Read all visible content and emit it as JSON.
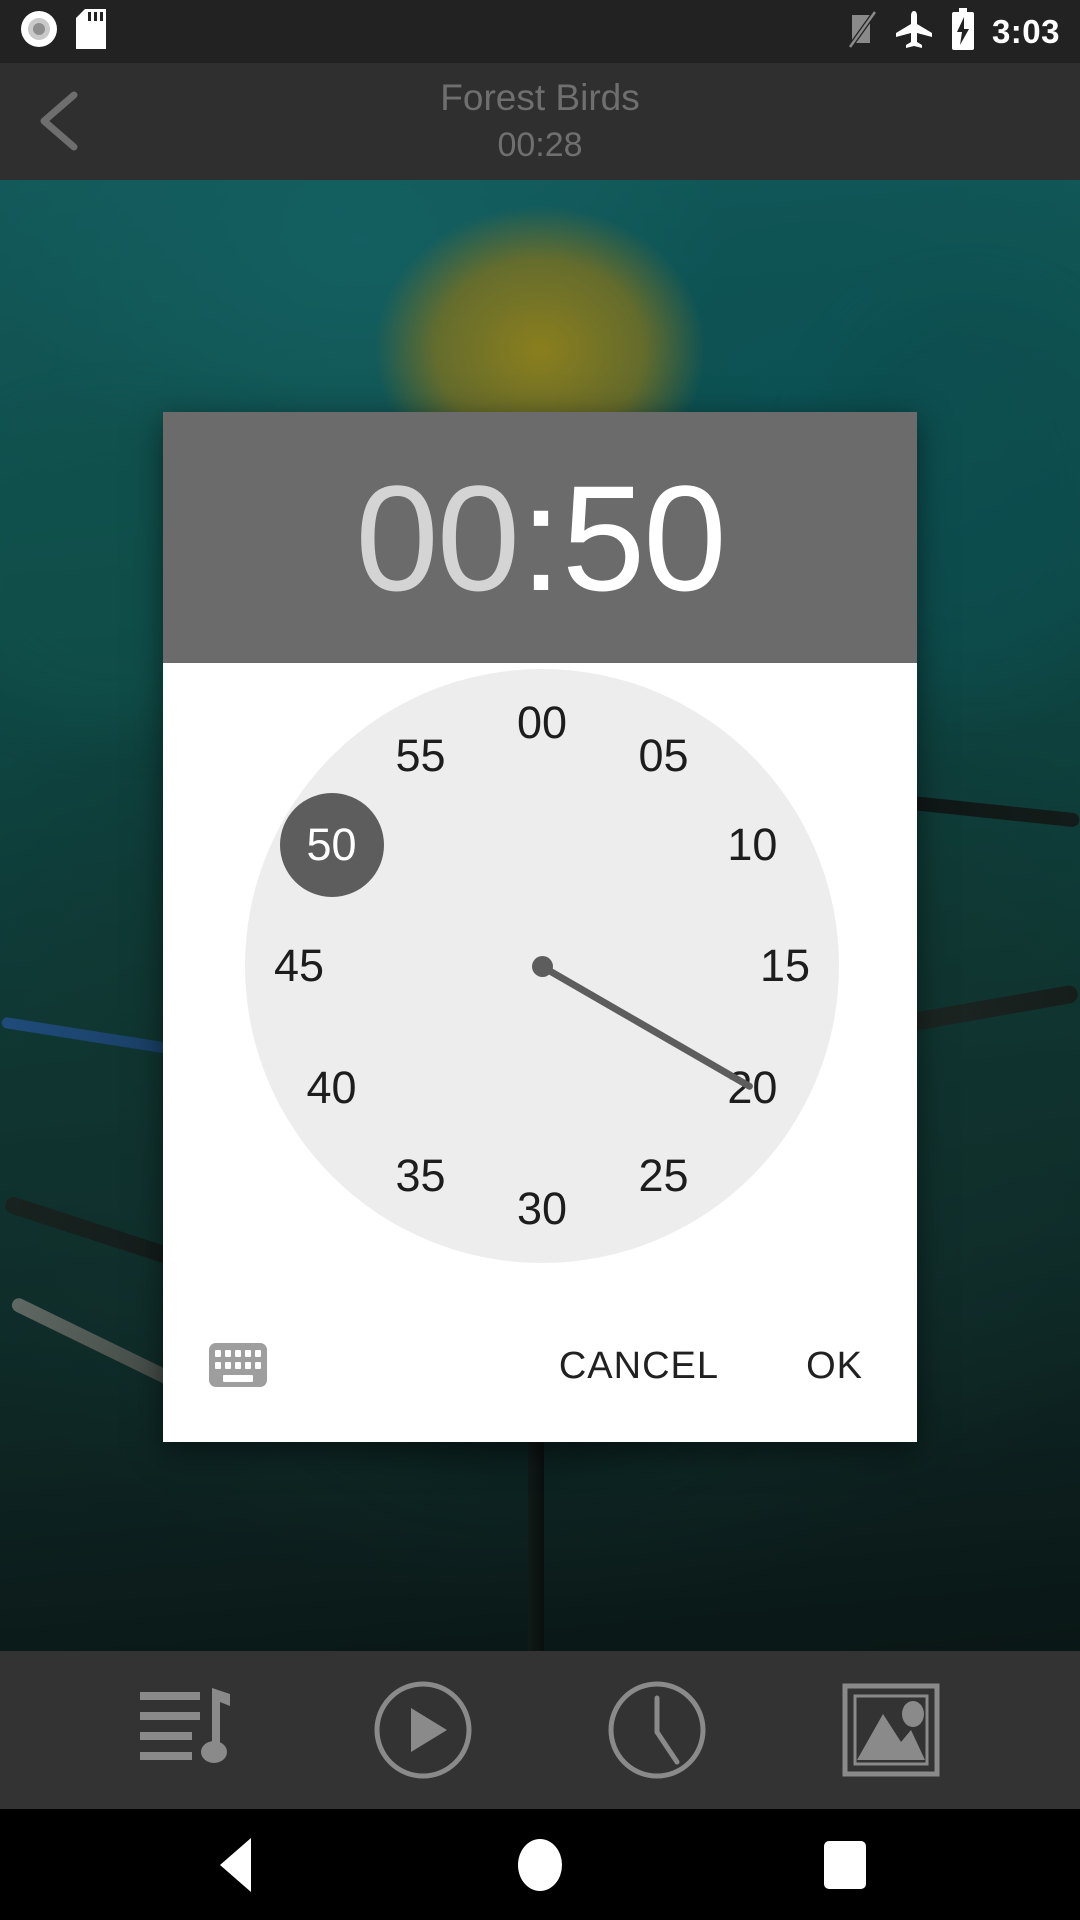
{
  "statusbar": {
    "icons_left": [
      "record-disc-icon",
      "sd-card-icon"
    ],
    "icons_right": [
      "signal-off-icon",
      "airplane-mode-icon",
      "battery-charging-icon"
    ],
    "clock": "3:03"
  },
  "appbar": {
    "back_icon": "chevron-left-icon",
    "title": "Forest Birds",
    "subtitle": "00:28"
  },
  "dialog": {
    "time": {
      "hours": "00",
      "separator": ":",
      "minutes": "50"
    },
    "clock": {
      "selected_value": "50",
      "ticks": [
        "00",
        "05",
        "10",
        "15",
        "20",
        "25",
        "30",
        "35",
        "40",
        "45",
        "50",
        "55"
      ],
      "face_color": "#ededed",
      "selection_color": "#5d5d5d"
    },
    "actions": {
      "keyboard_icon": "keyboard-icon",
      "cancel_label": "CANCEL",
      "ok_label": "OK"
    },
    "header_color": "#6b6b6b"
  },
  "toolbar": {
    "items": [
      {
        "icon": "playlist-music-icon"
      },
      {
        "icon": "play-circle-icon"
      },
      {
        "icon": "clock-icon"
      },
      {
        "icon": "image-gallery-icon"
      }
    ]
  },
  "navbar": {
    "items": [
      {
        "icon": "back-triangle-icon"
      },
      {
        "icon": "home-circle-icon"
      },
      {
        "icon": "recents-square-icon"
      }
    ]
  }
}
